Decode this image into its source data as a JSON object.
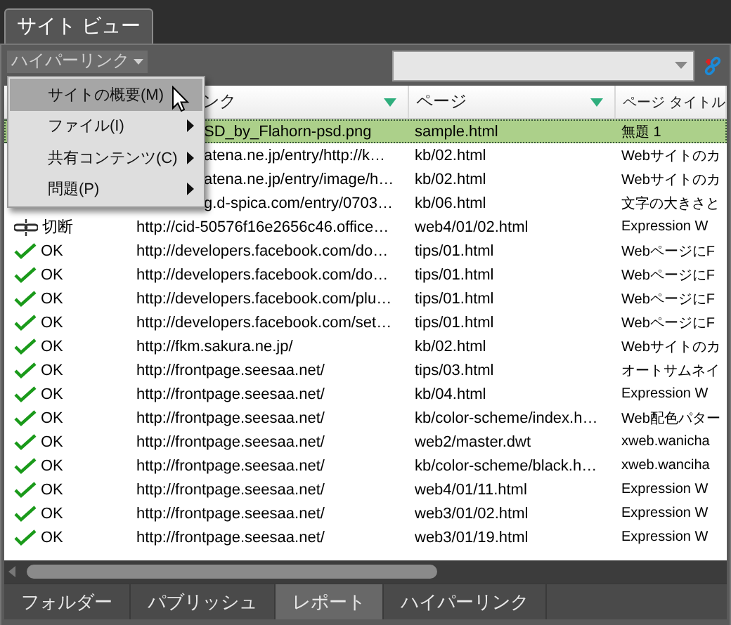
{
  "window": {
    "tab": "サイト ビュー"
  },
  "toolbar": {
    "view_button": "ハイパーリンク"
  },
  "menu": {
    "items": [
      {
        "label": "サイトの概要(M)",
        "selected": true,
        "has_submenu": false
      },
      {
        "label": "ファイル(I)",
        "selected": false,
        "has_submenu": true
      },
      {
        "label": "共有コンテンツ(C)",
        "selected": false,
        "has_submenu": true
      },
      {
        "label": "問題(P)",
        "selected": false,
        "has_submenu": true
      }
    ]
  },
  "table": {
    "columns": [
      {
        "label": "ンク",
        "sort_arrow": true,
        "clipped_left": true
      },
      {
        "label": "ページ",
        "sort_arrow": true,
        "clipped_left": false
      },
      {
        "label": "ページ タイトル",
        "sort_arrow": false,
        "clipped_left": false
      }
    ],
    "rows": [
      {
        "selected": true,
        "link": "SD_by_Flahorn-psd.png",
        "link_clipped_left": true,
        "page": "sample.html",
        "title": "無題 1"
      },
      {
        "selected": false,
        "link": "atena.ne.jp/entry/http://k…",
        "link_clipped_left": true,
        "page": "kb/02.html",
        "title": "Webサイトのカ"
      },
      {
        "selected": false,
        "link": "atena.ne.jp/entry/image/h…",
        "link_clipped_left": true,
        "page": "kb/02.html",
        "title": "Webサイトのカ"
      },
      {
        "selected": false,
        "link": "g.d-spica.com/entry/0703…",
        "link_clipped_left": true,
        "page": "kb/06.html",
        "title": "文字の大きさと"
      },
      {
        "selected": false,
        "kind": "broken",
        "status": "切断",
        "link": "http://cid-50576f16e2656c46.office…",
        "link_clipped_left": false,
        "page": "web4/01/02.html",
        "title": "Expression W"
      },
      {
        "selected": false,
        "kind": "ok",
        "status": "OK",
        "link": "http://developers.facebook.com/do…",
        "link_clipped_left": false,
        "page": "tips/01.html",
        "title": "WebページにF"
      },
      {
        "selected": false,
        "kind": "ok",
        "status": "OK",
        "link": "http://developers.facebook.com/do…",
        "link_clipped_left": false,
        "page": "tips/01.html",
        "title": "WebページにF"
      },
      {
        "selected": false,
        "kind": "ok",
        "status": "OK",
        "link": "http://developers.facebook.com/plu…",
        "link_clipped_left": false,
        "page": "tips/01.html",
        "title": "WebページにF"
      },
      {
        "selected": false,
        "kind": "ok",
        "status": "OK",
        "link": "http://developers.facebook.com/set…",
        "link_clipped_left": false,
        "page": "tips/01.html",
        "title": "WebページにF"
      },
      {
        "selected": false,
        "kind": "ok",
        "status": "OK",
        "link": "http://fkm.sakura.ne.jp/",
        "link_clipped_left": false,
        "page": "kb/02.html",
        "title": "Webサイトのカ"
      },
      {
        "selected": false,
        "kind": "ok",
        "status": "OK",
        "link": "http://frontpage.seesaa.net/",
        "link_clipped_left": false,
        "page": "tips/03.html",
        "title": "オートサムネイ"
      },
      {
        "selected": false,
        "kind": "ok",
        "status": "OK",
        "link": "http://frontpage.seesaa.net/",
        "link_clipped_left": false,
        "page": "kb/04.html",
        "title": "Expression W"
      },
      {
        "selected": false,
        "kind": "ok",
        "status": "OK",
        "link": "http://frontpage.seesaa.net/",
        "link_clipped_left": false,
        "page": "kb/color-scheme/index.h…",
        "title": "Web配色パター"
      },
      {
        "selected": false,
        "kind": "ok",
        "status": "OK",
        "link": "http://frontpage.seesaa.net/",
        "link_clipped_left": false,
        "page": "web2/master.dwt",
        "title": "xweb.wanicha"
      },
      {
        "selected": false,
        "kind": "ok",
        "status": "OK",
        "link": "http://frontpage.seesaa.net/",
        "link_clipped_left": false,
        "page": "kb/color-scheme/black.h…",
        "title": "xweb.wanciha"
      },
      {
        "selected": false,
        "kind": "ok",
        "status": "OK",
        "link": "http://frontpage.seesaa.net/",
        "link_clipped_left": false,
        "page": "web4/01/11.html",
        "title": "Expression W"
      },
      {
        "selected": false,
        "kind": "ok",
        "status": "OK",
        "link": "http://frontpage.seesaa.net/",
        "link_clipped_left": false,
        "page": "web3/01/02.html",
        "title": "Expression W"
      },
      {
        "selected": false,
        "kind": "ok",
        "status": "OK",
        "link": "http://frontpage.seesaa.net/",
        "link_clipped_left": false,
        "page": "web3/01/19.html",
        "title": "Expression W"
      }
    ]
  },
  "bottom_tabs": [
    {
      "label": "フォルダー",
      "selected": false
    },
    {
      "label": "パブリッシュ",
      "selected": false
    },
    {
      "label": "レポート",
      "selected": true
    },
    {
      "label": "ハイパーリンク",
      "selected": false
    }
  ]
}
